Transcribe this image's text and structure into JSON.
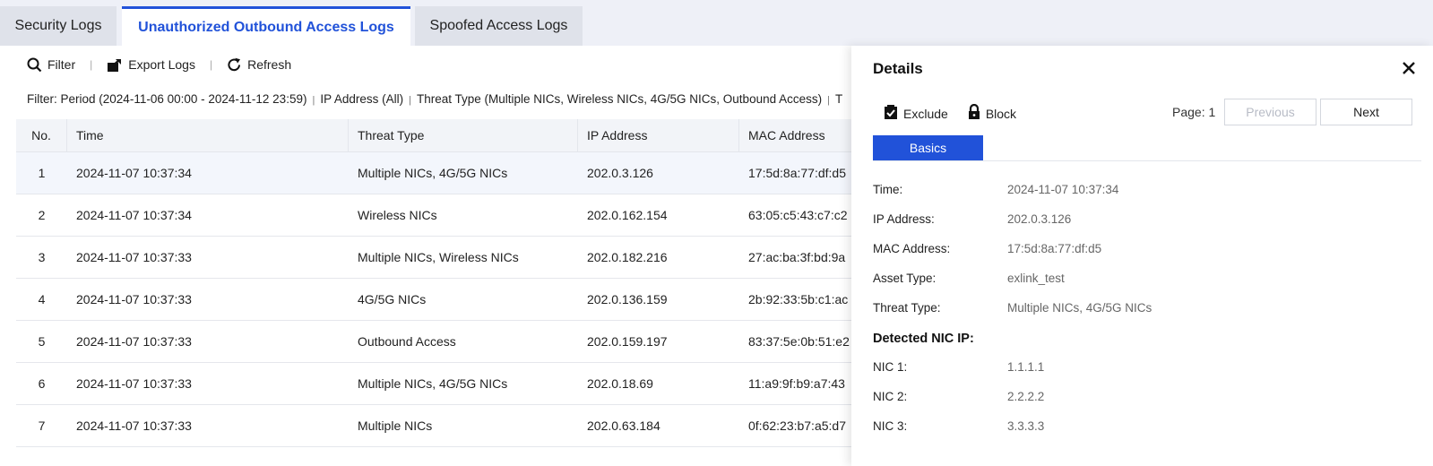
{
  "tabs": [
    {
      "label": "Security Logs"
    },
    {
      "label": "Unauthorized Outbound Access Logs"
    },
    {
      "label": "Spoofed Access Logs"
    }
  ],
  "toolbar": {
    "filter_label": "Filter",
    "export_label": "Export Logs",
    "refresh_label": "Refresh"
  },
  "filterbar": {
    "prefix": "Filter: ",
    "items": [
      "Period (2024-11-06 00:00 - 2024-11-12 23:59)",
      "IP Address (All)",
      "Threat Type (Multiple NICs, Wireless NICs, 4G/5G NICs, Outbound Access)",
      "T"
    ]
  },
  "table": {
    "columns": [
      "No.",
      "Time",
      "Threat Type",
      "IP Address",
      "MAC Address"
    ],
    "rows": [
      {
        "no": "1",
        "time": "2024-11-07 10:37:34",
        "threat": "Multiple NICs, 4G/5G NICs",
        "ip": "202.0.3.126",
        "mac": "17:5d:8a:77:df:d5"
      },
      {
        "no": "2",
        "time": "2024-11-07 10:37:34",
        "threat": "Wireless NICs",
        "ip": "202.0.162.154",
        "mac": "63:05:c5:43:c7:c2"
      },
      {
        "no": "3",
        "time": "2024-11-07 10:37:33",
        "threat": "Multiple NICs, Wireless NICs",
        "ip": "202.0.182.216",
        "mac": "27:ac:ba:3f:bd:9a"
      },
      {
        "no": "4",
        "time": "2024-11-07 10:37:33",
        "threat": "4G/5G NICs",
        "ip": "202.0.136.159",
        "mac": "2b:92:33:5b:c1:ac"
      },
      {
        "no": "5",
        "time": "2024-11-07 10:37:33",
        "threat": "Outbound Access",
        "ip": "202.0.159.197",
        "mac": "83:37:5e:0b:51:e2"
      },
      {
        "no": "6",
        "time": "2024-11-07 10:37:33",
        "threat": "Multiple NICs, 4G/5G NICs",
        "ip": "202.0.18.69",
        "mac": "11:a9:9f:b9:a7:43"
      },
      {
        "no": "7",
        "time": "2024-11-07 10:37:33",
        "threat": "Multiple NICs",
        "ip": "202.0.63.184",
        "mac": "0f:62:23:b7:a5:d7"
      }
    ]
  },
  "details": {
    "title": "Details",
    "exclude_label": "Exclude",
    "block_label": "Block",
    "page_label": "Page: 1",
    "prev_label": "Previous",
    "next_label": "Next",
    "tab_label": "Basics",
    "fields": [
      {
        "k": "Time:",
        "v": "2024-11-07 10:37:34"
      },
      {
        "k": "IP Address:",
        "v": "202.0.3.126"
      },
      {
        "k": "MAC Address:",
        "v": "17:5d:8a:77:df:d5"
      },
      {
        "k": "Asset Type:",
        "v": "exlink_test"
      },
      {
        "k": "Threat Type:",
        "v": "Multiple NICs, 4G/5G NICs"
      }
    ],
    "nic_section": "Detected NIC IP:",
    "nics": [
      {
        "k": "NIC 1:",
        "v": "1.1.1.1"
      },
      {
        "k": "NIC 2:",
        "v": "2.2.2.2"
      },
      {
        "k": "NIC 3:",
        "v": "3.3.3.3"
      }
    ]
  },
  "colors": {
    "accent": "#2152d9",
    "background": "#eef0f7"
  }
}
